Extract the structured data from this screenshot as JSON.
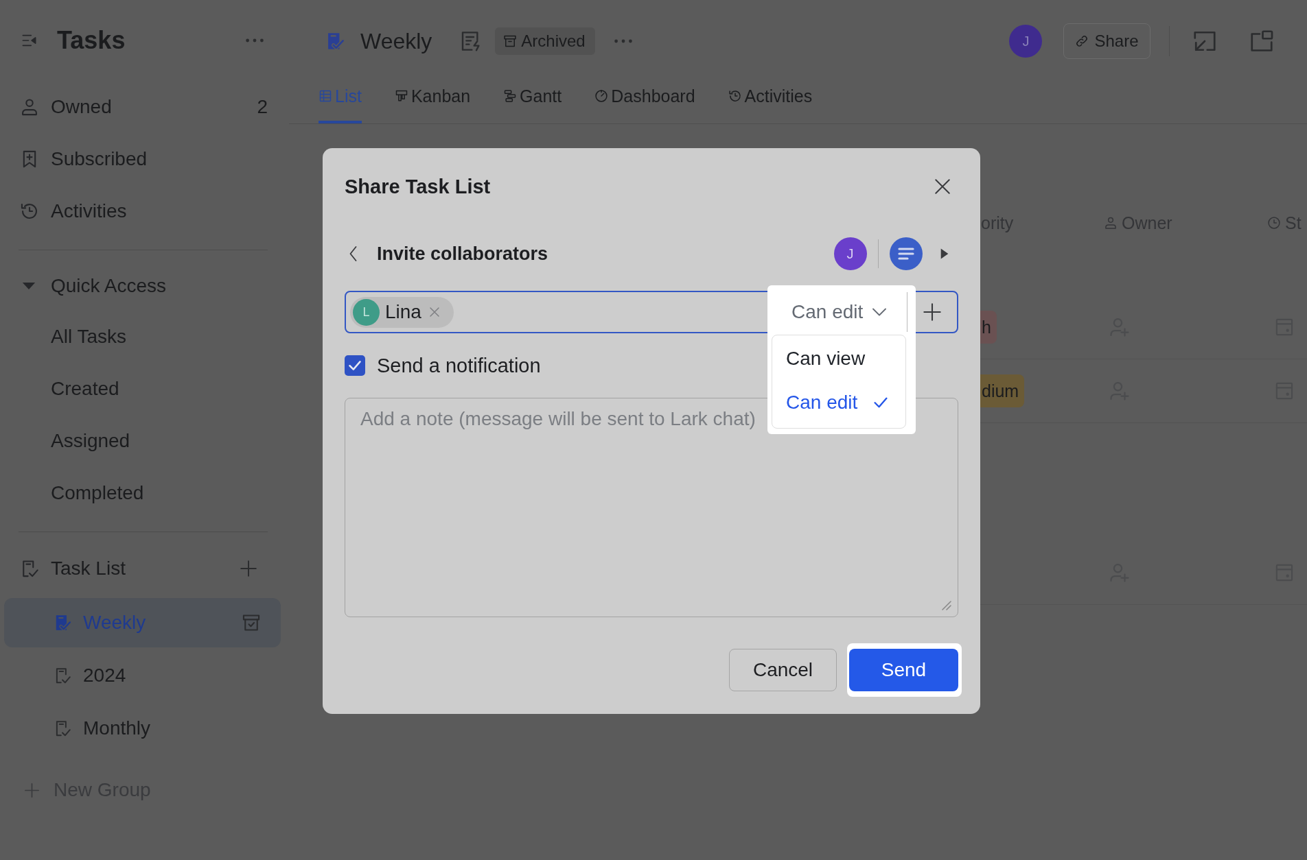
{
  "sidebar": {
    "title": "Tasks",
    "nav": [
      {
        "label": "Owned",
        "count": "2"
      },
      {
        "label": "Subscribed"
      },
      {
        "label": "Activities"
      }
    ],
    "quick_access": {
      "label": "Quick Access",
      "expanded": true,
      "items": [
        "All Tasks",
        "Created",
        "Assigned",
        "Completed"
      ]
    },
    "task_list": {
      "label": "Task List",
      "items": [
        {
          "label": "Weekly",
          "selected": true
        },
        {
          "label": "2024",
          "selected": false
        },
        {
          "label": "Monthly",
          "selected": false
        }
      ]
    },
    "new_group": "New Group"
  },
  "header": {
    "title": "Weekly",
    "badge": "Archived",
    "avatar": "J",
    "share": "Share"
  },
  "tabs": [
    {
      "label": "List",
      "selected": true
    },
    {
      "label": "Kanban",
      "selected": false
    },
    {
      "label": "Gantt",
      "selected": false
    },
    {
      "label": "Dashboard",
      "selected": false
    },
    {
      "label": "Activities",
      "selected": false
    }
  ],
  "table": {
    "columns": [
      "ority",
      "Owner",
      "St"
    ],
    "groups": [
      {
        "rows": [
          {
            "kind": "tagged",
            "tag": {
              "text": "h",
              "color": "#6a5152"
            }
          },
          {
            "kind": "tagged",
            "tag": {
              "text": "dium",
              "color": "#6b5b36"
            }
          }
        ]
      },
      {
        "rows": [
          {
            "kind": "plain"
          }
        ]
      }
    ]
  },
  "dialog": {
    "title": "Share Task List",
    "subtitle": "Invite collaborators",
    "avatar": "J",
    "invite_field": {
      "chips": [
        {
          "initial": "L",
          "name": "Lina"
        }
      ],
      "permission": {
        "label": "Can edit",
        "highlighted": true,
        "options": [
          {
            "label": "Can view",
            "selected": false
          },
          {
            "label": "Can edit",
            "selected": true
          }
        ]
      }
    },
    "notify": {
      "label": "Send a notification",
      "checked": true
    },
    "note": {
      "placeholder": "Add a note (message will be sent to Lark chat)"
    },
    "buttons": [
      {
        "label": "Cancel",
        "kind": "secondary",
        "highlighted": false
      },
      {
        "label": "Send",
        "kind": "primary",
        "highlighted": true
      }
    ]
  }
}
